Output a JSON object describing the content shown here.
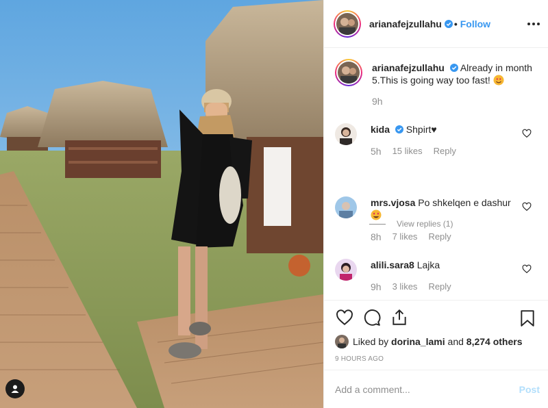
{
  "post": {
    "author": "arianafejzullahu",
    "follow_label": "Follow",
    "dot": "•",
    "caption_text": "Already in month 5.This is going way too fast!",
    "caption_time": "9h"
  },
  "comments": [
    {
      "username": "kida",
      "verified": true,
      "text": "Shpirt♥",
      "time": "5h",
      "likes": "15 likes",
      "reply": "Reply"
    },
    {
      "username": "mrs.vjosa",
      "verified": false,
      "text": "Po shkelqen e dashur",
      "time": "8h",
      "likes": "7 likes",
      "reply": "Reply"
    },
    {
      "username": "alili.sara8",
      "verified": false,
      "text": "Lajka",
      "time": "9h",
      "likes": "3 likes",
      "reply": "Reply"
    }
  ],
  "view_replies": "View replies (1)",
  "likes": {
    "liked_by_prefix": "Liked by",
    "liker": "dorina_lami",
    "and": "and",
    "others": "8,274 others"
  },
  "post_time": "9 HOURS AGO",
  "add_comment": {
    "placeholder": "Add a comment...",
    "post_label": "Post"
  },
  "colors": {
    "link": "#3897f0",
    "post_disabled": "#b2dffc",
    "muted": "#8e8e8e",
    "verified": "#3897f0"
  },
  "icons": [
    "heart-icon",
    "comment-icon",
    "share-icon",
    "bookmark-icon",
    "more-options-icon",
    "user-tag-icon",
    "verified-badge-icon"
  ]
}
